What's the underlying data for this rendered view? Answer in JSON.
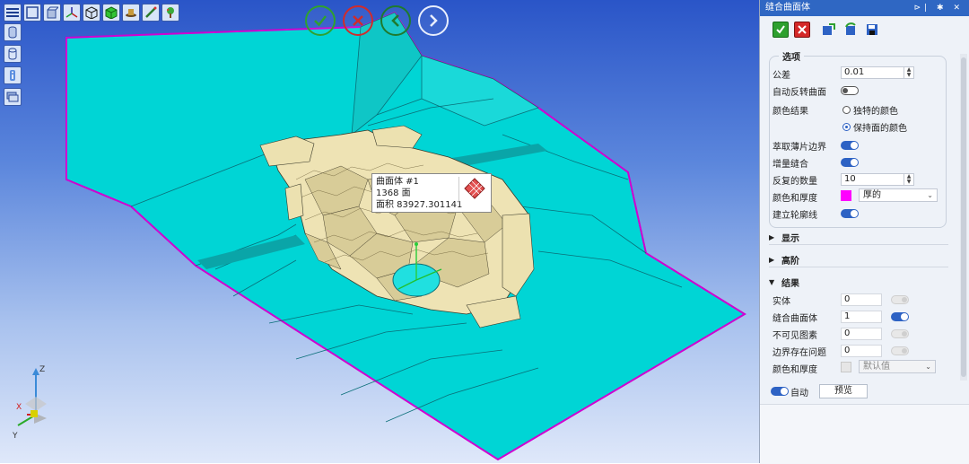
{
  "toolbar": {
    "icons": [
      "menu-icon",
      "view-box-icon",
      "view-cube-icon",
      "axis-icon",
      "wireframe-cube-icon",
      "solid-cube-icon",
      "hat-icon",
      "edit-icon",
      "tree-icon"
    ],
    "side_icons": [
      "cylinder-icon",
      "cylinder-outline-icon",
      "info-icon",
      "layers-icon"
    ]
  },
  "nav": {
    "ok": "check-icon",
    "cancel": "close-icon",
    "back": "back-icon",
    "forward": "forward-icon"
  },
  "tooltip": {
    "line1": "曲面体 #1",
    "line2": "1368 面",
    "line3": "面积 83927.301141"
  },
  "triad": {
    "z": "Z",
    "x": "X",
    "y": "Y"
  },
  "panel": {
    "title": "缝合曲面体",
    "title_buttons": "⊳| ✱ ✕",
    "options": {
      "label": "选项",
      "tolerance_label": "公差",
      "tolerance_value": "0.01",
      "auto_reverse_label": "自动反转曲面",
      "color_result_label": "颜色结果",
      "color_option1": "独特的颜色",
      "color_option2": "保持面的颜色",
      "extract_label": "萃取薄片边界",
      "incremental_label": "增量缝合",
      "repeat_label": "反复的数量",
      "repeat_value": "10",
      "color_thickness_label": "颜色和厚度",
      "thickness_value": "厚的",
      "build_outline_label": "建立轮廓线"
    },
    "display_label": "显示",
    "advanced_label": "高阶",
    "results": {
      "label": "结果",
      "solid_label": "实体",
      "solid_value": "0",
      "stitched_label": "缝合曲面体",
      "stitched_value": "1",
      "invisible_label": "不可见图素",
      "invisible_value": "0",
      "boundary_label": "边界存在问题",
      "boundary_value": "0",
      "color_label": "颜色和厚度",
      "color_value": "默认值"
    },
    "auto_label": "自动",
    "preview_label": "预览",
    "colors": {
      "accent": "#2d62c4",
      "title_bar": "#2f67c3",
      "swatch": "#ff00ff"
    }
  }
}
